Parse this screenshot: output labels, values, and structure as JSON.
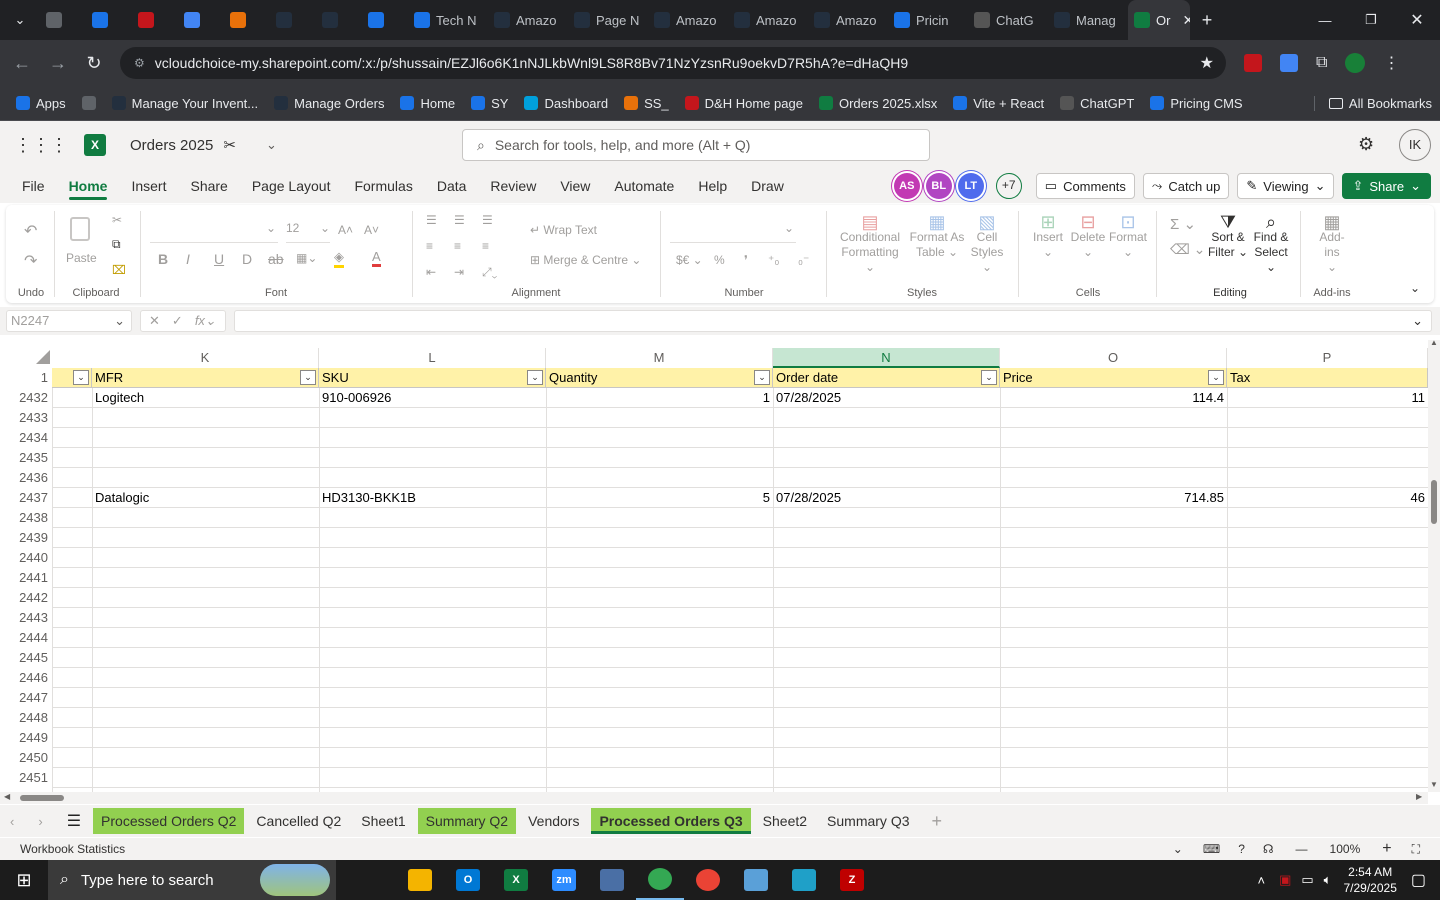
{
  "browser": {
    "tabs": [
      {
        "label": "",
        "icon": "generic-icon",
        "color": "#5f6368"
      },
      {
        "label": "",
        "icon": "ec-icon",
        "color": "#1a73e8"
      },
      {
        "label": "",
        "icon": "dh-icon",
        "color": "#c4161c"
      },
      {
        "label": "",
        "icon": "g-icon",
        "color": "#4285f4"
      },
      {
        "label": "",
        "icon": "box-icon",
        "color": "#e8710a"
      },
      {
        "label": "",
        "icon": "amazon-icon",
        "color": "#232f3e"
      },
      {
        "label": "",
        "icon": "amazon-icon",
        "color": "#232f3e"
      },
      {
        "label": "",
        "icon": "dollar-icon",
        "color": "#1a73e8"
      },
      {
        "label": "Tech N",
        "icon": "ec-icon",
        "color": "#1a73e8"
      },
      {
        "label": "Amazo",
        "icon": "amazon-icon",
        "color": "#232f3e"
      },
      {
        "label": "Page N",
        "icon": "amazon-icon",
        "color": "#232f3e"
      },
      {
        "label": "Amazo",
        "icon": "amazon-icon",
        "color": "#232f3e"
      },
      {
        "label": "Amazo",
        "icon": "amazon-icon",
        "color": "#232f3e"
      },
      {
        "label": "Amazo",
        "icon": "amazon-icon",
        "color": "#232f3e"
      },
      {
        "label": "Pricin",
        "icon": "dollar-icon",
        "color": "#1a73e8"
      },
      {
        "label": "ChatG",
        "icon": "chatgpt-icon",
        "color": "#555"
      },
      {
        "label": "Manag",
        "icon": "amazon-icon",
        "color": "#232f3e"
      },
      {
        "label": "Or",
        "icon": "excel-icon",
        "color": "#107c41",
        "active": true
      }
    ],
    "new_tab": "+",
    "url_host": "vcloudchoice-my.sharepoint.com",
    "url_path": "/:x:/p/shussain/EZJl6o6K1nNJLkbWnl9LS8R8Bv71NzYzsnRu9oekvD7R5hA?e=dHaQH9",
    "bookmarks": [
      {
        "label": "Apps",
        "color": "#1a73e8"
      },
      {
        "label": "",
        "color": "#5f6368"
      },
      {
        "label": "Manage Your Invent...",
        "color": "#232f3e"
      },
      {
        "label": "Manage Orders",
        "color": "#232f3e"
      },
      {
        "label": "Home",
        "color": "#1a73e8"
      },
      {
        "label": "SY",
        "color": "#1a73e8"
      },
      {
        "label": "Dashboard",
        "color": "#00a0dc"
      },
      {
        "label": "SS_",
        "color": "#e8710a"
      },
      {
        "label": "D&H Home page",
        "color": "#c4161c"
      },
      {
        "label": "Orders 2025.xlsx",
        "color": "#107c41"
      },
      {
        "label": "Vite + React",
        "color": "#1a73e8"
      },
      {
        "label": "ChatGPT",
        "color": "#555"
      },
      {
        "label": "Pricing CMS",
        "color": "#1a73e8"
      }
    ],
    "all_bookmarks": "All Bookmarks"
  },
  "excel": {
    "doc_title": "Orders 2025",
    "search_placeholder": "Search for tools, help, and more (Alt + Q)",
    "user_initials": "IK",
    "menu": [
      "File",
      "Home",
      "Insert",
      "Share",
      "Page Layout",
      "Formulas",
      "Data",
      "Review",
      "View",
      "Automate",
      "Help",
      "Draw"
    ],
    "active_menu": "Home",
    "presence": [
      {
        "initials": "AS",
        "color": "#c239b3"
      },
      {
        "initials": "BL",
        "color": "#b146c2"
      },
      {
        "initials": "LT",
        "color": "#4f6bed"
      }
    ],
    "presence_more": "+7",
    "comments_label": "Comments",
    "catchup_label": "Catch up",
    "viewing_label": "Viewing",
    "share_label": "Share",
    "ribbon": {
      "undo_label": "Undo",
      "clipboard_label": "Clipboard",
      "paste_label": "Paste",
      "font_label": "Font",
      "font_size": "12",
      "alignment_label": "Alignment",
      "wrap_text": "Wrap Text",
      "merge_centre": "Merge & Centre",
      "number_label": "Number",
      "styles_label": "Styles",
      "conditional_1": "Conditional",
      "conditional_2": "Formatting",
      "format_as_1": "Format As",
      "format_as_2": "Table",
      "cell_1": "Cell",
      "cell_2": "Styles",
      "cells_label": "Cells",
      "insert": "Insert",
      "delete": "Delete",
      "format": "Format",
      "editing_label": "Editing",
      "sort_1": "Sort &",
      "sort_2": "Filter",
      "find_1": "Find &",
      "find_2": "Select",
      "addins": "Add-ins",
      "addins_label": "Add-ins"
    },
    "name_box": "N2247",
    "fx": "fx",
    "columns": [
      "K",
      "L",
      "M",
      "N",
      "O",
      "P"
    ],
    "header_row_num": "1",
    "headers": [
      "MFR",
      "SKU",
      "Quantity",
      "Order date",
      "Price",
      "Tax"
    ],
    "rows": [
      {
        "num": "2432",
        "cells": [
          "Logitech",
          "910-006926",
          "1",
          "07/28/2025",
          "114.4",
          "11"
        ]
      },
      {
        "num": "2433",
        "cells": [
          "",
          "",
          "",
          "",
          "",
          ""
        ]
      },
      {
        "num": "2434",
        "cells": [
          "",
          "",
          "",
          "",
          "",
          ""
        ]
      },
      {
        "num": "2435",
        "cells": [
          "",
          "",
          "",
          "",
          "",
          ""
        ]
      },
      {
        "num": "2436",
        "cells": [
          "",
          "",
          "",
          "",
          "",
          ""
        ]
      },
      {
        "num": "2437",
        "cells": [
          "Datalogic",
          "HD3130-BKK1B",
          "5",
          "07/28/2025",
          "714.85",
          "46"
        ]
      },
      {
        "num": "2438",
        "cells": [
          "",
          "",
          "",
          "",
          "",
          ""
        ]
      },
      {
        "num": "2439",
        "cells": [
          "",
          "",
          "",
          "",
          "",
          ""
        ]
      },
      {
        "num": "2440",
        "cells": [
          "",
          "",
          "",
          "",
          "",
          ""
        ]
      },
      {
        "num": "2441",
        "cells": [
          "",
          "",
          "",
          "",
          "",
          ""
        ]
      },
      {
        "num": "2442",
        "cells": [
          "",
          "",
          "",
          "",
          "",
          ""
        ]
      },
      {
        "num": "2443",
        "cells": [
          "",
          "",
          "",
          "",
          "",
          ""
        ]
      },
      {
        "num": "2444",
        "cells": [
          "",
          "",
          "",
          "",
          "",
          ""
        ]
      },
      {
        "num": "2445",
        "cells": [
          "",
          "",
          "",
          "",
          "",
          ""
        ]
      },
      {
        "num": "2446",
        "cells": [
          "",
          "",
          "",
          "",
          "",
          ""
        ]
      },
      {
        "num": "2447",
        "cells": [
          "",
          "",
          "",
          "",
          "",
          ""
        ]
      },
      {
        "num": "2448",
        "cells": [
          "",
          "",
          "",
          "",
          "",
          ""
        ]
      },
      {
        "num": "2449",
        "cells": [
          "",
          "",
          "",
          "",
          "",
          ""
        ]
      },
      {
        "num": "2450",
        "cells": [
          "",
          "",
          "",
          "",
          "",
          ""
        ]
      },
      {
        "num": "2451",
        "cells": [
          "",
          "",
          "",
          "",
          "",
          ""
        ]
      }
    ],
    "sheets": [
      {
        "label": "Processed Orders Q2",
        "style": "green"
      },
      {
        "label": "Cancelled Q2",
        "style": ""
      },
      {
        "label": "Sheet1",
        "style": ""
      },
      {
        "label": "Summary Q2",
        "style": "green"
      },
      {
        "label": "Vendors",
        "style": ""
      },
      {
        "label": "Processed Orders Q3",
        "style": "active"
      },
      {
        "label": "Sheet2",
        "style": ""
      },
      {
        "label": "Summary Q3",
        "style": ""
      }
    ],
    "add_sheet": "+",
    "status_left": "Workbook Statistics",
    "zoom": "100%"
  },
  "taskbar": {
    "search_placeholder": "Type here to search",
    "apps": [
      {
        "name": "task-view-icon",
        "label": "",
        "color": "#1c1c1c"
      },
      {
        "name": "file-explorer-icon",
        "label": "",
        "color": "#f4b400"
      },
      {
        "name": "outlook-icon",
        "label": "O",
        "color": "#0078d4"
      },
      {
        "name": "excel-icon",
        "label": "X",
        "color": "#107c41"
      },
      {
        "name": "zoom-icon",
        "label": "zm",
        "color": "#2d8cff"
      },
      {
        "name": "calculator-icon",
        "label": "",
        "color": "#4a6fa5"
      },
      {
        "name": "chrome-icon",
        "label": "",
        "color": "#34a853"
      },
      {
        "name": "chrome-icon",
        "label": "",
        "color": "#ea4335"
      },
      {
        "name": "app-icon",
        "label": "",
        "color": "#5aa0d8"
      },
      {
        "name": "app-icon",
        "label": "",
        "color": "#1fa0c8"
      },
      {
        "name": "filezilla-icon",
        "label": "Z",
        "color": "#bf0000"
      }
    ],
    "time": "2:54 AM",
    "date": "7/29/2025"
  },
  "colors": {
    "excel_green": "#107c41",
    "header_yellow": "#fff2a8",
    "selected_col": "#c6e6d2",
    "sheet_green": "#92d050"
  }
}
